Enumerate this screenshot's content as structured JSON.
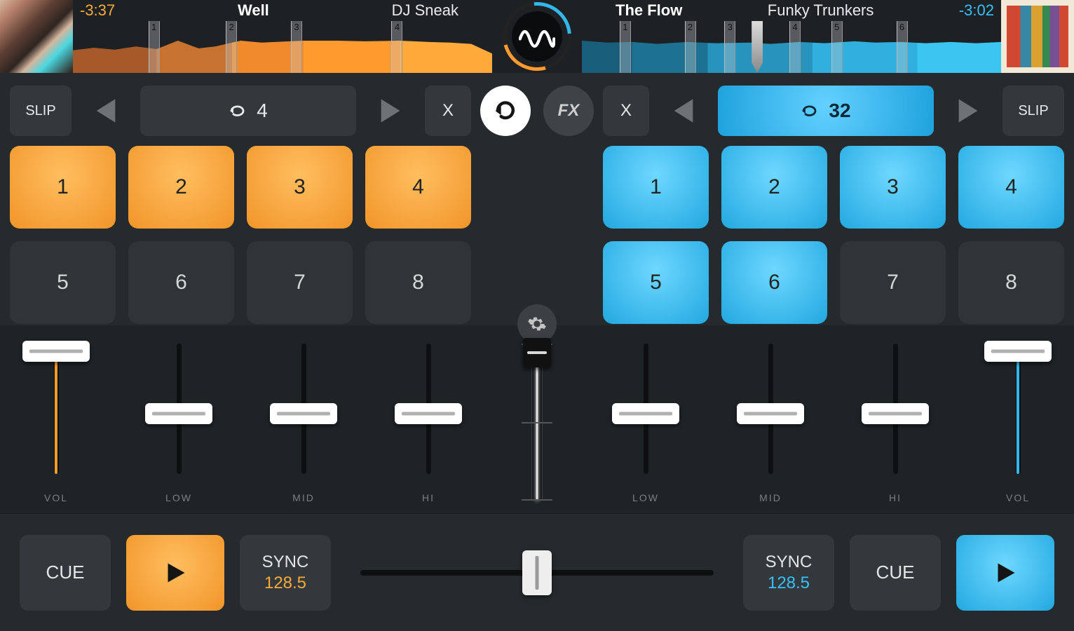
{
  "deck_a": {
    "time_remaining": "-3:37",
    "title": "Well",
    "artist": "DJ Sneak",
    "slip_label": "SLIP",
    "x_label": "X",
    "loop_value": "4",
    "pads": [
      "1",
      "2",
      "3",
      "4",
      "5",
      "6",
      "7",
      "8"
    ],
    "pad_active": [
      true,
      true,
      true,
      true,
      false,
      false,
      false,
      false
    ],
    "wave_markers": [
      {
        "label": "1",
        "pos": 18
      },
      {
        "label": "2",
        "pos": 36.5
      },
      {
        "label": "3",
        "pos": 52
      },
      {
        "label": "4",
        "pos": 76
      }
    ],
    "eq_labels": [
      "LOW",
      "MID",
      "HI"
    ],
    "vol_label": "VOL",
    "cue_label": "CUE",
    "sync_label": "SYNC",
    "sync_bpm": "128.5"
  },
  "deck_b": {
    "time_remaining": "-3:02",
    "title": "The Flow",
    "artist": "Funky Trunkers",
    "slip_label": "SLIP",
    "x_label": "X",
    "loop_value": "32",
    "pads": [
      "1",
      "2",
      "3",
      "4",
      "5",
      "6",
      "7",
      "8"
    ],
    "pad_active": [
      true,
      true,
      true,
      true,
      true,
      true,
      false,
      false
    ],
    "wave_markers": [
      {
        "label": "1",
        "pos": 9
      },
      {
        "label": "2",
        "pos": 24.5
      },
      {
        "label": "3",
        "pos": 34
      },
      {
        "label": "4",
        "pos": 49.5
      },
      {
        "label": "5",
        "pos": 59.5
      },
      {
        "label": "6",
        "pos": 75
      }
    ],
    "play_cursor_pos": 40.5,
    "eq_labels": [
      "LOW",
      "MID",
      "HI"
    ],
    "vol_label": "VOL",
    "cue_label": "CUE",
    "sync_label": "SYNC",
    "sync_bpm": "128.5"
  },
  "center": {
    "fx_label": "FX"
  },
  "colors": {
    "orange": "#ff9a2f",
    "blue": "#33b7ea"
  }
}
